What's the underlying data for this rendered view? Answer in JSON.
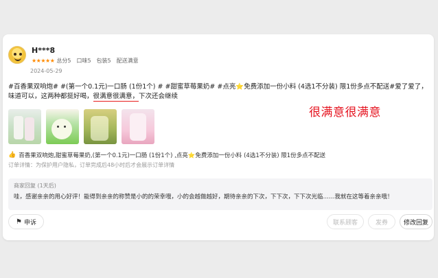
{
  "review": {
    "username": "H***8",
    "stars": "★★★★★",
    "scores": [
      "总分5",
      "口味5",
      "包装5",
      "配送满意"
    ],
    "date": "2024-05-29",
    "text_part1": "#百香果双响炮# #(第一个0.1元)一口肠 (1份1个) # #甜蜜草莓果奶# #点亮",
    "star_emoji": "⭐",
    "text_part2": "免费添加一份小料 (4选1不分装) 限1份多点不配送#爱了爱了，味道可以，这两种都挺好喝，",
    "highlight": "很满意很满意，",
    "text_part3": "下次还会继续",
    "annotation": "很满意很满意",
    "photos": [
      "photo-1",
      "photo-2",
      "photo-3",
      "photo-4"
    ],
    "product_icon": "thumbs-up-icon",
    "products": "百香果双响炮,甜蜜草莓果奶,(第一个0.1元)一口肠 (1份1个) ,点亮⭐免费添加一份小料 (4选1不分装) 限1份多点不配送",
    "order_info": "订单详情：为保护用户隐私，订单完成后48小时后才会展示订单详情"
  },
  "merchant_reply": {
    "title": "商家回复 (1天后)",
    "text": "哇，感谢亲亲的用心好评！能得到亲亲的称赞是小的的荣幸哦，小的会越做越好，期待亲亲的下次，下下次，下下次光临……我就在这等着亲亲哦！"
  },
  "actions": {
    "report_icon": "report-icon",
    "report": "申诉",
    "contact": "联系顾客",
    "coupon": "发券",
    "edit_reply": "修改回复"
  },
  "colors": {
    "accent_red": "#e5121e",
    "star_orange": "#ff8a00"
  }
}
